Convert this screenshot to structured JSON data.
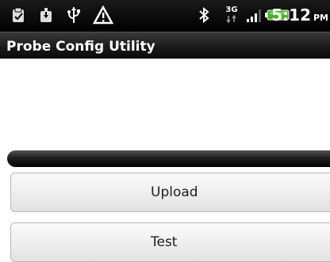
{
  "status_bar": {
    "time": "5:12",
    "ampm": "PM",
    "network": "3G",
    "icons": [
      "clipboard-icon",
      "download-icon",
      "usb-icon",
      "warning-icon",
      "bluetooth-icon",
      "network-3g-icon",
      "signal-icon",
      "battery-icon"
    ]
  },
  "app": {
    "title": "Probe Config Utility"
  },
  "progress": {
    "value": 0
  },
  "buttons": {
    "upload_label": "Upload",
    "test_label": "Test"
  },
  "colors": {
    "status_bar_bg": "#000000",
    "title_bar_bg": "#1b1b1b",
    "battery": "#4caf2a",
    "button_bg": "#efefef",
    "button_border": "#b8b8b8"
  }
}
